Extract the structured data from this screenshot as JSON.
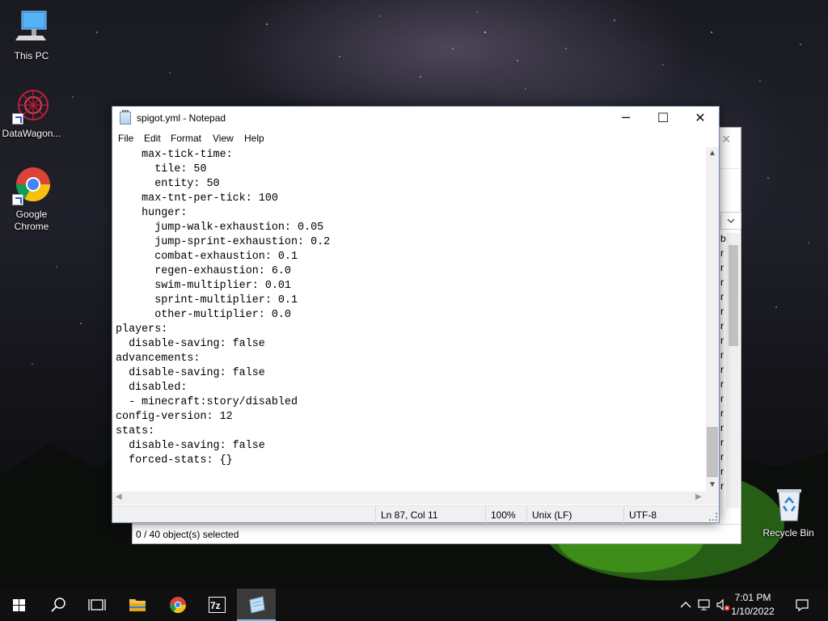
{
  "desktop": {
    "icons": [
      {
        "label": "This PC"
      },
      {
        "label": "DataWagon..."
      },
      {
        "label": "Google Chrome"
      },
      {
        "label": "Recycle Bin"
      }
    ]
  },
  "explorer": {
    "status": "0 / 40 object(s) selected",
    "column_letters": [
      "b",
      "r",
      "r",
      "r",
      "r",
      "r",
      "r",
      "r",
      "r",
      "r",
      "r",
      "r",
      "r",
      "r",
      "r",
      "r",
      "r",
      "r"
    ]
  },
  "notepad": {
    "title": "spigot.yml - Notepad",
    "menu": [
      "File",
      "Edit",
      "Format",
      "View",
      "Help"
    ],
    "lines": [
      "    max-tick-time:",
      "      tile: 50",
      "      entity: 50",
      "    max-tnt-per-tick: 100",
      "    hunger:",
      "      jump-walk-exhaustion: 0.05",
      "      jump-sprint-exhaustion: 0.2",
      "      combat-exhaustion: 0.1",
      "      regen-exhaustion: 6.0",
      "      swim-multiplier: 0.01",
      "      sprint-multiplier: 0.1",
      "      other-multiplier: 0.0",
      "players:",
      "  disable-saving: false",
      "advancements:",
      "  disable-saving: false",
      "  disabled:",
      "  - minecraft:story/disabled",
      "config-version: 12",
      "stats:",
      "  disable-saving: false",
      "  forced-stats: {}"
    ],
    "status": {
      "position": "Ln 87, Col 11",
      "zoom": "100%",
      "line_ending": "Unix (LF)",
      "encoding": "UTF-8"
    },
    "window_buttons": {
      "minimize": "─",
      "maximize": "☐",
      "close": "✕"
    }
  },
  "taskbar": {
    "time": "7:01 PM",
    "date": "1/10/2022",
    "pinned": [
      "start",
      "search",
      "task-view",
      "file-explorer",
      "chrome",
      "7zip",
      "notepad"
    ],
    "active": "notepad"
  },
  "colors": {
    "taskbar": "#101010",
    "accent": "#76b9ed",
    "window_border": "#6f8bb0"
  }
}
